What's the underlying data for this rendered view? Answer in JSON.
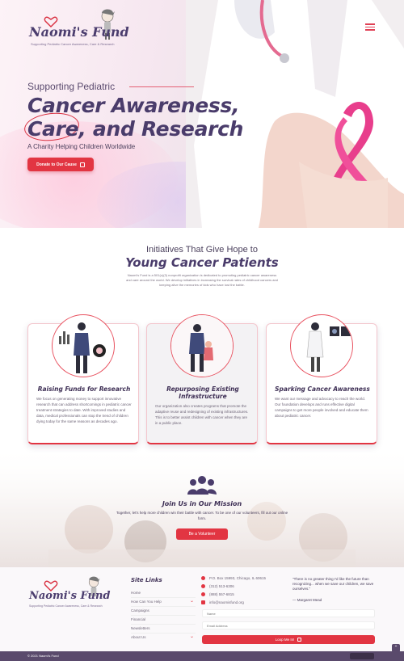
{
  "brand": {
    "name": "Naomi's Fund",
    "tagline": "Supporting Pediatric Cancer Awareness, Care & Research"
  },
  "hero": {
    "subtitle": "Supporting Pediatric",
    "title_line1": "Cancer Awareness,",
    "title_line2": "Care, and Research",
    "tagline": "A Charity Helping Children Worldwide",
    "donate_label": "Donate to Our Cause"
  },
  "initiatives": {
    "heading": "Initiatives That Give Hope to",
    "heading2": "Young Cancer Patients",
    "description": "Naomi's Fund is a 501(c)(3) nonprofit organization is dedicated to promoting pediatric cancer awareness and care around the world. We develop initiatives in increasing the survival rates of childhood cancers and keeping alive the memories of kids who have lost the battle.",
    "cards": [
      {
        "title": "Raising Funds for Research",
        "text": "We focus on generating money to support innovative research that can address shortcomings in pediatric cancer treatment strategies to date. With improved studies and data, medical professionals can stop the trend of children dying today for the same reasons as decades ago."
      },
      {
        "title": "Repurposing Existing Infrastructure",
        "text": "Our organization also creates programs that promote the adaptive reuse and redesigning of existing infrastructures. This is to better assist children with cancer when they are in a public place."
      },
      {
        "title": "Sparking Cancer Awareness",
        "text": "We want our message and advocacy to reach the world. Our foundation develops and runs effective digital campaigns to get more people involved and educate them about pediatric cancer."
      }
    ]
  },
  "join": {
    "title": "Join Us in Our Mission",
    "description": "Together, let's help more children win their battle with cancer. To be one of our volunteers, fill out our online form.",
    "button_label": "Be a Volunteer"
  },
  "footer": {
    "links_title": "Site Links",
    "links": [
      "Home",
      "How Can You Help",
      "Campaigns",
      "Financial",
      "Newsletters",
      "About Us"
    ],
    "contact": {
      "address": "P.O. Box 15993, Chicago, IL 60615",
      "phone1": "(312) 513-6306",
      "phone2": "(888) 557-6815",
      "email": "info@naomisfund.org"
    },
    "quote": "\"There is no greater thing I'd like the future than recognizing... when we save our children, we save ourselves.\"",
    "quote_author": "— Margaret Mead",
    "name_placeholder": "Name",
    "email_placeholder": "Email Address",
    "submit_label": "Loop Me In!",
    "copyright": "© 2021 Naomi's Fund"
  },
  "colors": {
    "accent": "#e23542",
    "brand_purple": "#4a3c6b",
    "bar": "#5a4a6c"
  }
}
